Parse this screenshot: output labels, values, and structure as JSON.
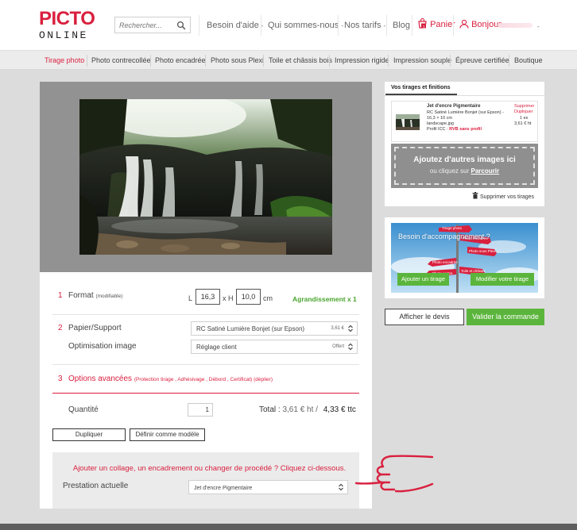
{
  "header": {
    "logo_top": "PICTO",
    "logo_bottom": "ONLINE",
    "search_placeholder": "Rechercher...",
    "nav": {
      "help": "Besoin d'aide",
      "about": "Qui sommes-nous",
      "prices": "Nos tarifs",
      "blog": "Blog",
      "cart": "Panier",
      "cart_count": "1",
      "greeting": "Bonjour",
      "dash": "-"
    }
  },
  "products": [
    "Tirage photo",
    "Photo contrecollée",
    "Photo encadrée",
    "Photo sous Plexi",
    "Toile et châssis bois",
    "Impression rigide",
    "Impression souple",
    "Épreuve certifiée",
    "Boutique"
  ],
  "order": {
    "format": {
      "num": "1",
      "label": "Format",
      "note": "(modifiable)",
      "l_label": "L",
      "width": "16,3",
      "x_label": "x H",
      "height": "10,0",
      "unit": "cm",
      "enlargement": "Agrandissement x 1"
    },
    "paper": {
      "num": "2",
      "label": "Papier/Support",
      "value": "RC Satiné Lumière Bonjet (sur Epson)",
      "price": "3,61 €"
    },
    "optim": {
      "label": "Optimisation image",
      "value": "Réglage client",
      "price": "Offert"
    },
    "advanced": {
      "num": "3",
      "label": "Options avancées",
      "details": "(Protection tirage , Adhésivage , Débord , Certificat) (déplier)"
    },
    "quantity": {
      "label": "Quantité",
      "value": "1"
    },
    "total": {
      "label": "Total :",
      "ht": "3,61 € ht",
      "slash": "/",
      "ttc": "4,33 € ttc"
    },
    "duplicate_btn": "Dupliquer",
    "model_btn": "Définir comme modèle",
    "collage_text": "Ajouter un collage, un encadrement ou changer de procédé ? Cliquez ci-dessous.",
    "prestation_label": "Prestation actuelle",
    "prestation_value": "Jet d'encre Pigmentaire"
  },
  "tirages": {
    "tab_label": "Vos tirages et finitions",
    "item": {
      "title": "Jet d'encre Pigmentaire",
      "line1": "RC Satiné Lumière Bonjet (sur Epson) -",
      "line2": "16,3 × 10 cm",
      "line3": "landscape.jpg",
      "profile_label": "Profil ICC :",
      "profile_value": "RVB sans profil",
      "delete": "Supprimer",
      "duplicate": "Dupliquer",
      "qty": "1 ex",
      "price": "3,61 € ht"
    },
    "drop_title": "Ajoutez d'autres images ici",
    "drop_sub": "ou cliquez sur",
    "drop_link": "Parcourir",
    "delete_all": "Supprimer vos tirages"
  },
  "accompaniment": {
    "title": "Besoin d'accompagnement ?",
    "sign1": "Tirage photo",
    "sign2": "Photo encadrée",
    "sign3": "Photo sous Plexi",
    "sign4": "Photo encadrée",
    "sign5": "Toile et châssis",
    "sign6": "Photo contre",
    "add_btn": "Ajouter un tirage",
    "modify_btn": "Modifier votre tirage"
  },
  "actions": {
    "quote_btn": "Afficher le devis",
    "validate_btn": "Valider la commande"
  },
  "colors": {
    "brand": "#d9203f",
    "green": "#5bb53c",
    "preview_bg": "#929292"
  }
}
